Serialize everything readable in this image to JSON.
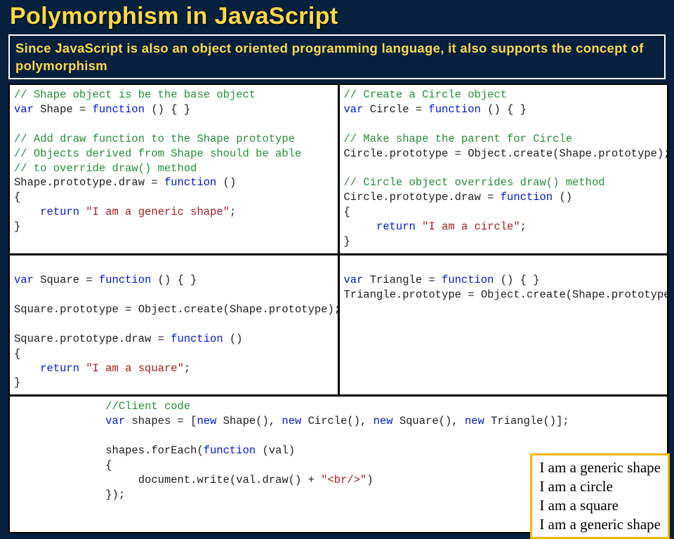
{
  "title": "Polymorphism in JavaScript",
  "intro": "Since JavaScript is also an object oriented programming language, it also supports the concept of polymorphism",
  "code": {
    "shape": {
      "c1": "// Shape object is be the base object",
      "v1a": "var",
      "v1b": " Shape = ",
      "v1c": "function",
      "v1d": " () { }",
      "c2": "// Add draw function to the Shape prototype",
      "c3": "// Objects derived from Shape should be able",
      "c4": "// to override draw() method",
      "l1a": "Shape.prototype.draw = ",
      "l1b": "function",
      "l1c": " ()",
      "l2": "{",
      "l3a": "    ",
      "l3b": "return ",
      "l3c": "\"I am a generic shape\"",
      "l3d": ";",
      "l4": "}"
    },
    "circle": {
      "c1": "// Create a Circle object",
      "v1a": "var",
      "v1b": " Circle = ",
      "v1c": "function",
      "v1d": " () { }",
      "c2": "// Make shape the parent for Circle",
      "p1": "Circle.prototype = Object.create(Shape.prototype);",
      "c3": "// Circle object overrides draw() method",
      "l1a": "Circle.prototype.draw = ",
      "l1b": "function",
      "l1c": " ()",
      "l2": "{",
      "l3a": "     ",
      "l3b": "return ",
      "l3c": "\"I am a circle\"",
      "l3d": ";",
      "l4": "}"
    },
    "square": {
      "v1a": "var",
      "v1b": " Square = ",
      "v1c": "function",
      "v1d": " () { }",
      "p1": "Square.prototype = Object.create(Shape.prototype);",
      "l1a": "Square.prototype.draw = ",
      "l1b": "function",
      "l1c": " ()",
      "l2": "{",
      "l3a": "    ",
      "l3b": "return ",
      "l3c": "\"I am a square\"",
      "l3d": ";",
      "l4": "}"
    },
    "triangle": {
      "v1a": "var",
      "v1b": " Triangle = ",
      "v1c": "function",
      "v1d": " () { }",
      "p1": "Triangle.prototype = Object.create(Shape.prototype);"
    },
    "client": {
      "pad": "              ",
      "c1": "//Client code",
      "l1a": "var",
      "l1b": " shapes = [",
      "l1c": "new",
      "l1d": " Shape(), ",
      "l1e": "new",
      "l1f": " Circle(), ",
      "l1g": "new",
      "l1h": " Square(), ",
      "l1i": "new",
      "l1j": " Triangle()];",
      "l2a": "shapes.forEach(",
      "l2b": "function",
      "l2c": " (val)",
      "l3": "{",
      "l4a": "     document.write(val.draw() + ",
      "l4b": "\"<br/>\"",
      "l4c": ")",
      "l5": "});"
    }
  },
  "output": {
    "o1": "I am a generic shape",
    "o2": "I am a circle",
    "o3": "I am a square",
    "o4": "I am a generic shape"
  }
}
